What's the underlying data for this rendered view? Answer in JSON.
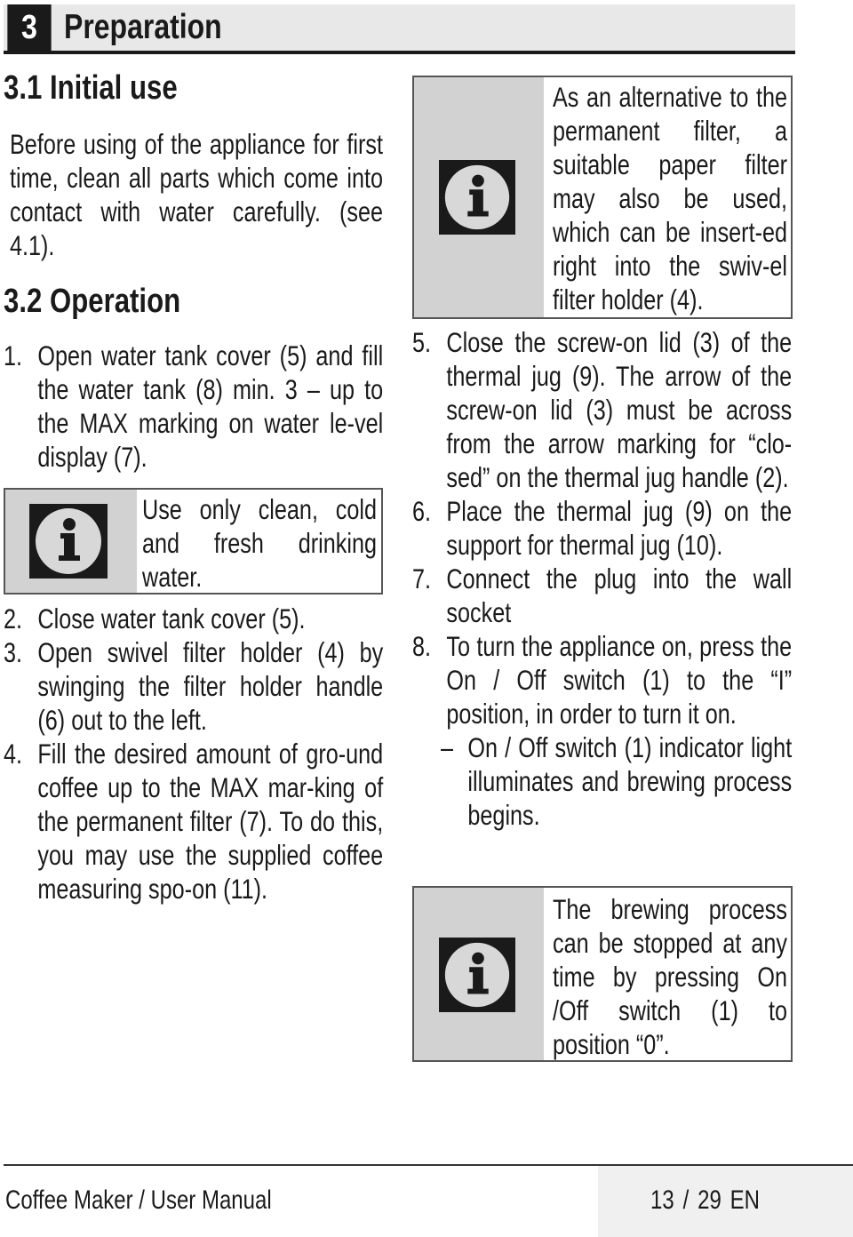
{
  "chapter": {
    "number": "3",
    "title": "Preparation"
  },
  "section_1": {
    "heading": "3.1 Initial use",
    "paragraph": "Before using of the appliance for first time, clean all parts which come into contact with water carefully. (see 4.1)."
  },
  "section_2": {
    "heading": "3.2 Operation",
    "steps": [
      {
        "num": "1.",
        "text": "Open water tank cover (5) and fill the water tank (8) min. 3 – up to the MAX marking on water le-vel display (7)."
      },
      {
        "num": "2.",
        "text": "Close water tank cover (5)."
      },
      {
        "num": "3.",
        "text": "Open swivel filter holder (4) by swinging the filter holder handle (6) out to the left."
      },
      {
        "num": "4.",
        "text": "Fill the desired amount of gro-und coffee up to the MAX mar-king of the permanent filter (7). To do this, you may use the supplied coffee measuring spo-on (11)."
      },
      {
        "num": "5.",
        "text": "Close the screw-on lid (3) of the thermal jug (9). The arrow of the screw-on lid (3) must be across from the arrow marking for “clo-sed” on the thermal jug handle (2)."
      },
      {
        "num": "6.",
        "text": "Place the thermal jug (9) on the support for thermal jug (10)."
      },
      {
        "num": "7.",
        "text": "Connect the plug into the wall socket"
      },
      {
        "num": "8.",
        "text": "To turn the appliance on, press the On / Off switch (1) to the “I” position, in order to turn it on."
      }
    ],
    "sub_step": {
      "bullet": "–",
      "text": "On / Off switch (1) indicator light illuminates and brewing process begins."
    }
  },
  "notes": {
    "water": {
      "icon": "info-icon",
      "text": "Use only clean, cold and fresh drinking water."
    },
    "paper_filter": {
      "icon": "info-icon",
      "text": "As an alternative to the permanent filter, a suitable paper filter may also be used, which can be insert-ed right into the swiv-el filter holder (4)."
    },
    "stop_brewing": {
      "icon": "info-icon",
      "text": "The brewing process can be stopped at any time by pressing On /Off switch (1) to position “0”."
    }
  },
  "footer": {
    "title": "Coffee Maker / User Manual",
    "page": "13 / 29",
    "language": "EN"
  }
}
